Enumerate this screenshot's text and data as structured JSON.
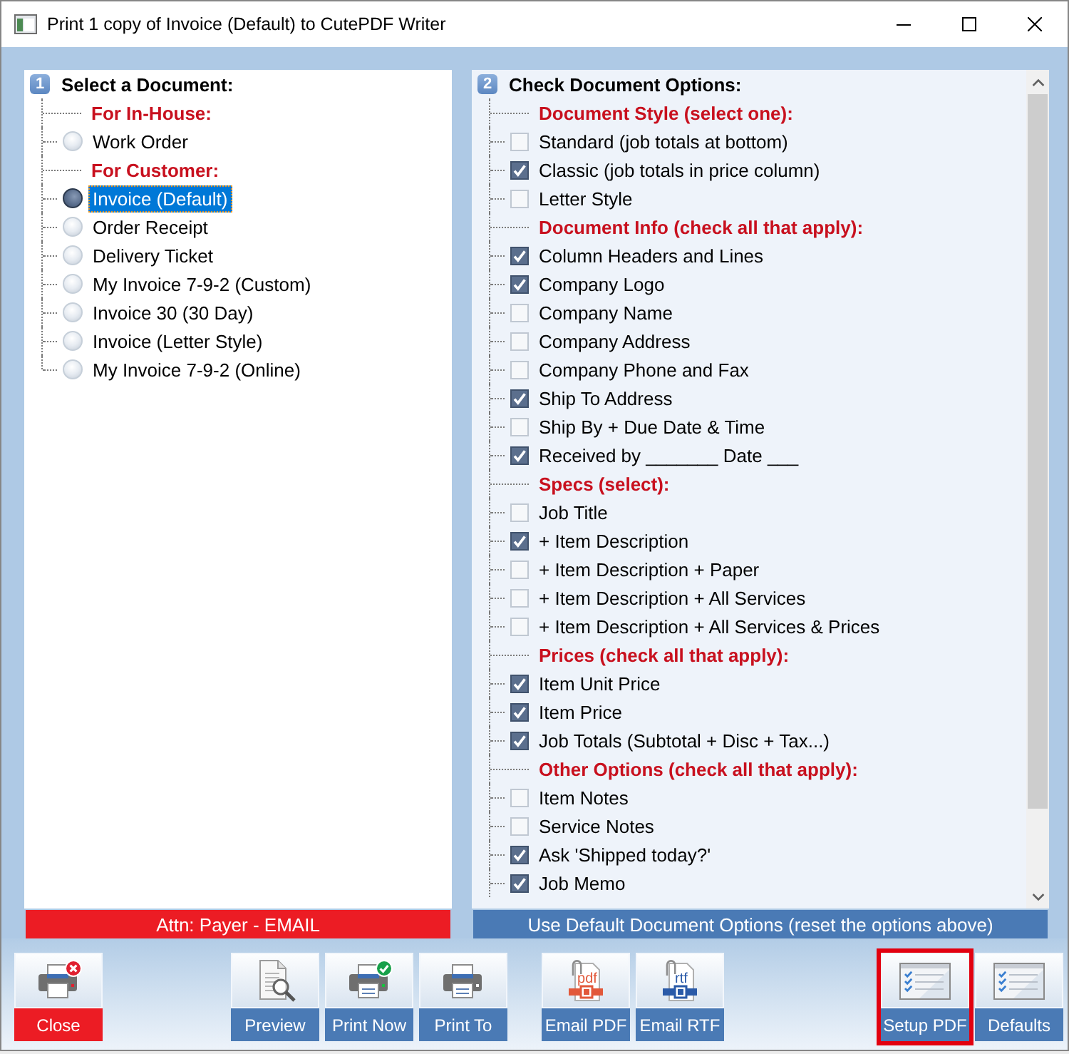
{
  "window": {
    "title": "Print 1 copy of Invoice (Default) to CutePDF Writer"
  },
  "document_panel": {
    "number": "1",
    "title": "Select a Document:",
    "items": [
      {
        "kind": "heading",
        "label": "For In-House:"
      },
      {
        "kind": "radio",
        "label": "Work Order",
        "selected": false
      },
      {
        "kind": "heading",
        "label": "For Customer:"
      },
      {
        "kind": "radio",
        "label": "Invoice (Default)",
        "selected": true
      },
      {
        "kind": "radio",
        "label": "Order Receipt",
        "selected": false
      },
      {
        "kind": "radio",
        "label": "Delivery Ticket",
        "selected": false
      },
      {
        "kind": "radio",
        "label": "My Invoice 7-9-2 (Custom)",
        "selected": false
      },
      {
        "kind": "radio",
        "label": "Invoice 30 (30 Day)",
        "selected": false
      },
      {
        "kind": "radio",
        "label": "Invoice (Letter Style)",
        "selected": false
      },
      {
        "kind": "radio",
        "label": "My Invoice 7-9-2 (Online)",
        "selected": false
      }
    ],
    "footer": "Attn: Payer - EMAIL"
  },
  "options_panel": {
    "number": "2",
    "title": "Check Document Options:",
    "items": [
      {
        "kind": "heading",
        "label": "Document Style (select one):"
      },
      {
        "kind": "checkbox",
        "label": "Standard (job totals at bottom)",
        "checked": false
      },
      {
        "kind": "checkbox",
        "label": "Classic (job totals in price column)",
        "checked": true
      },
      {
        "kind": "checkbox",
        "label": "Letter Style",
        "checked": false
      },
      {
        "kind": "heading",
        "label": "Document Info (check all that apply):"
      },
      {
        "kind": "checkbox",
        "label": "Column Headers and Lines",
        "checked": true
      },
      {
        "kind": "checkbox",
        "label": "Company Logo",
        "checked": true
      },
      {
        "kind": "checkbox",
        "label": "Company Name",
        "checked": false
      },
      {
        "kind": "checkbox",
        "label": "Company Address",
        "checked": false
      },
      {
        "kind": "checkbox",
        "label": "Company Phone and Fax",
        "checked": false
      },
      {
        "kind": "checkbox",
        "label": "Ship To Address",
        "checked": true
      },
      {
        "kind": "checkbox",
        "label": "Ship By + Due Date & Time",
        "checked": false
      },
      {
        "kind": "checkbox",
        "label": "Received by _______ Date ___",
        "checked": true
      },
      {
        "kind": "heading",
        "label": "Specs (select):"
      },
      {
        "kind": "checkbox",
        "label": "Job Title",
        "checked": false
      },
      {
        "kind": "checkbox",
        "label": "+ Item Description",
        "checked": true
      },
      {
        "kind": "checkbox",
        "label": "+ Item Description + Paper",
        "checked": false
      },
      {
        "kind": "checkbox",
        "label": "+ Item Description + All Services",
        "checked": false
      },
      {
        "kind": "checkbox",
        "label": "+ Item Description + All Services & Prices",
        "checked": false
      },
      {
        "kind": "heading",
        "label": "Prices (check all that apply):"
      },
      {
        "kind": "checkbox",
        "label": "Item Unit Price",
        "checked": true
      },
      {
        "kind": "checkbox",
        "label": "Item Price",
        "checked": true
      },
      {
        "kind": "checkbox",
        "label": "Job Totals (Subtotal + Disc + Tax...)",
        "checked": true
      },
      {
        "kind": "heading",
        "label": "Other Options (check all that apply):"
      },
      {
        "kind": "checkbox",
        "label": "Item Notes",
        "checked": false
      },
      {
        "kind": "checkbox",
        "label": "Service Notes",
        "checked": false
      },
      {
        "kind": "checkbox",
        "label": "Ask 'Shipped today?'",
        "checked": true
      },
      {
        "kind": "checkbox",
        "label": "Job Memo",
        "checked": true
      }
    ],
    "footer_button": "Use Default Document Options (reset the options above)"
  },
  "toolbar": {
    "groups": [
      {
        "buttons": [
          {
            "kind": "close",
            "label": "Close",
            "highlighted": false
          }
        ]
      },
      {
        "buttons": [
          {
            "kind": "preview",
            "label": "Preview",
            "highlighted": false
          },
          {
            "kind": "printnow",
            "label": "Print Now",
            "highlighted": false
          },
          {
            "kind": "printto",
            "label": "Print To",
            "highlighted": false
          }
        ]
      },
      {
        "buttons": [
          {
            "kind": "pdf",
            "label": "Email PDF",
            "icon_text": "pdf",
            "highlighted": false
          },
          {
            "kind": "rtf",
            "label": "Email RTF",
            "icon_text": "rtf",
            "highlighted": false
          }
        ]
      },
      {
        "buttons": [
          {
            "kind": "setup",
            "label": "Setup PDF",
            "highlighted": true
          },
          {
            "kind": "setup",
            "label": "Defaults",
            "highlighted": false
          }
        ]
      }
    ]
  }
}
